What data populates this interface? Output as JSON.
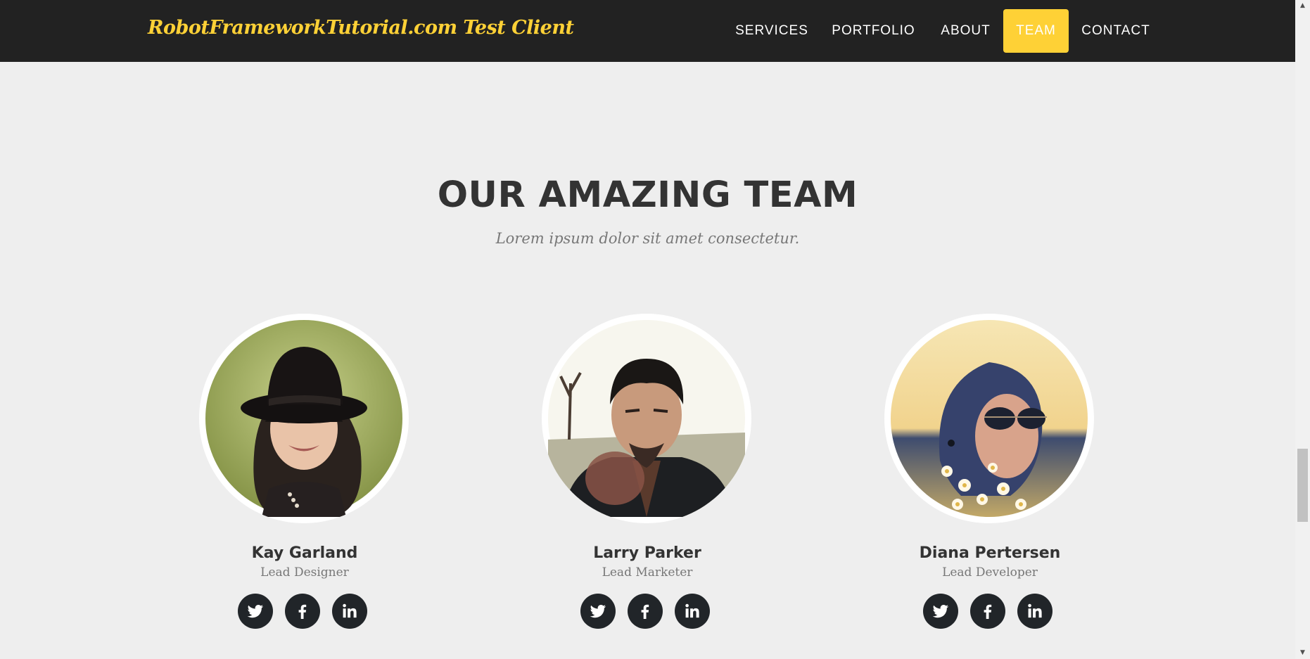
{
  "navbar": {
    "brand": "RobotFrameworkTutorial.com Test Client",
    "items": [
      {
        "label": "SERVICES",
        "active": false
      },
      {
        "label": "PORTFOLIO",
        "active": false
      },
      {
        "label": "ABOUT",
        "active": false
      },
      {
        "label": "TEAM",
        "active": true
      },
      {
        "label": "CONTACT",
        "active": false
      }
    ]
  },
  "team": {
    "heading": "OUR AMAZING TEAM",
    "subheading": "Lorem ipsum dolor sit amet consectetur.",
    "members": [
      {
        "name": "Kay Garland",
        "role": "Lead Designer",
        "photo": "woman-in-black-bowler-hat-photo",
        "social": [
          "twitter-icon",
          "facebook-icon",
          "linkedin-icon"
        ]
      },
      {
        "name": "Larry Parker",
        "role": "Lead Marketer",
        "photo": "man-in-leather-jacket-pointing-photo",
        "social": [
          "twitter-icon",
          "facebook-icon",
          "linkedin-icon"
        ]
      },
      {
        "name": "Diana Pertersen",
        "role": "Lead Developer",
        "photo": "woman-with-aviator-sunglasses-photo",
        "social": [
          "twitter-icon",
          "facebook-icon",
          "linkedin-icon"
        ]
      }
    ]
  },
  "colors": {
    "accent": "#fed136",
    "navbar_bg": "#222222",
    "page_bg": "#eeeeee",
    "heading": "#333333",
    "muted": "#777777",
    "social_bg": "#212529"
  },
  "scrollbar": {
    "up_arrow": "▲",
    "down_arrow": "▼"
  }
}
